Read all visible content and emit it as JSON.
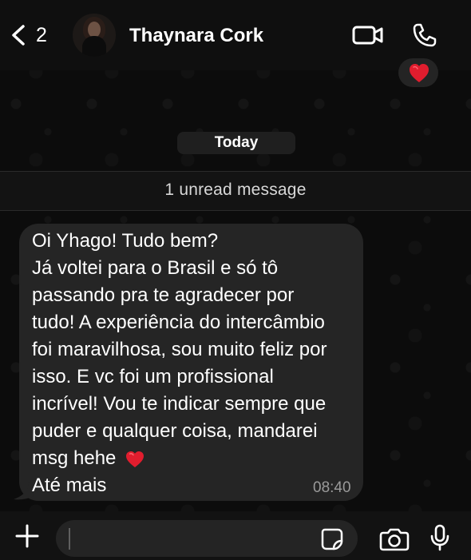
{
  "header": {
    "back_count": "2",
    "contact_name": "Thaynara Cork"
  },
  "chat": {
    "date_chip": "Today",
    "unread_label": "1 unread message",
    "message": {
      "lines": [
        "Oi Yhago! Tudo bem?",
        "Já voltei para o Brasil e só tô",
        "passando pra te agradecer por",
        "tudo! A experiência do intercâmbio",
        "foi maravilhosa, sou muito feliz por",
        "isso. E vc foi um profissional",
        "incrível! Vou te indicar sempre que",
        "puder e qualquer coisa, mandarei",
        "msg hehe",
        "Até mais"
      ],
      "emoji": "heart",
      "time": "08:40"
    },
    "reaction": {
      "emoji": "heart"
    }
  },
  "composer": {
    "placeholder": ""
  },
  "colors": {
    "background": "#0c0c0c",
    "bubble": "#252525",
    "heart": "#e11d2e",
    "text": "#ffffff",
    "muted": "#9a9a9a"
  },
  "icons": {
    "back": "chevron-left-icon",
    "video": "video-camera-icon",
    "phone": "phone-icon",
    "plus": "plus-icon",
    "sticker": "sticker-icon",
    "camera": "camera-icon",
    "microphone": "microphone-icon"
  }
}
